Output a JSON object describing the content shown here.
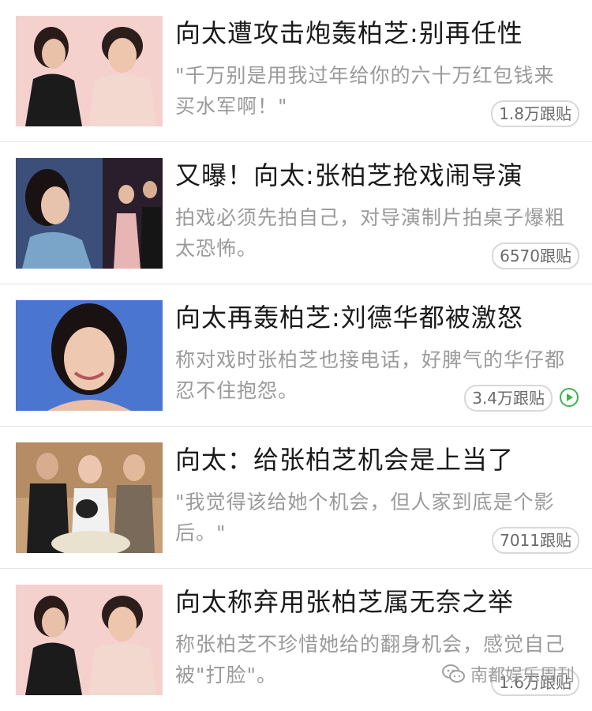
{
  "feed": {
    "items": [
      {
        "title": "向太遭攻击炮轰柏芝:别再任性",
        "summary": "\"千万别是用我过年给你的六十万红包钱来买水军啊！\"",
        "comments": "1.8万跟贴",
        "has_video": false
      },
      {
        "title": "又曝！向太:张柏芝抢戏闹导演",
        "summary": "拍戏必须先拍自己，对导演制片拍桌子爆粗太恐怖。",
        "comments": "6570跟贴",
        "has_video": false
      },
      {
        "title": "向太再轰柏芝:刘德华都被激怒",
        "summary": "称对戏时张柏芝也接电话，好脾气的华仔都忍不住抱怨。",
        "comments": "3.4万跟贴",
        "has_video": true
      },
      {
        "title": "向太：给张柏芝机会是上当了",
        "summary": "\"我觉得该给她个机会，但人家到底是个影后。\"",
        "comments": "7011跟贴",
        "has_video": false
      },
      {
        "title": "向太称弃用张柏芝属无奈之举",
        "summary": "称张柏芝不珍惜她给的翻身机会，感觉自己被\"打脸\"。",
        "comments": "1.6万跟贴",
        "has_video": false
      }
    ]
  },
  "watermark": {
    "text": "南都娱乐周刊",
    "icon": "wechat-icon"
  },
  "colors": {
    "title": "#1a1a1a",
    "summary": "#9a9a9a",
    "badge_border": "#d8d8d8",
    "play_accent": "#3fb34f",
    "divider": "#e4e4e4"
  }
}
